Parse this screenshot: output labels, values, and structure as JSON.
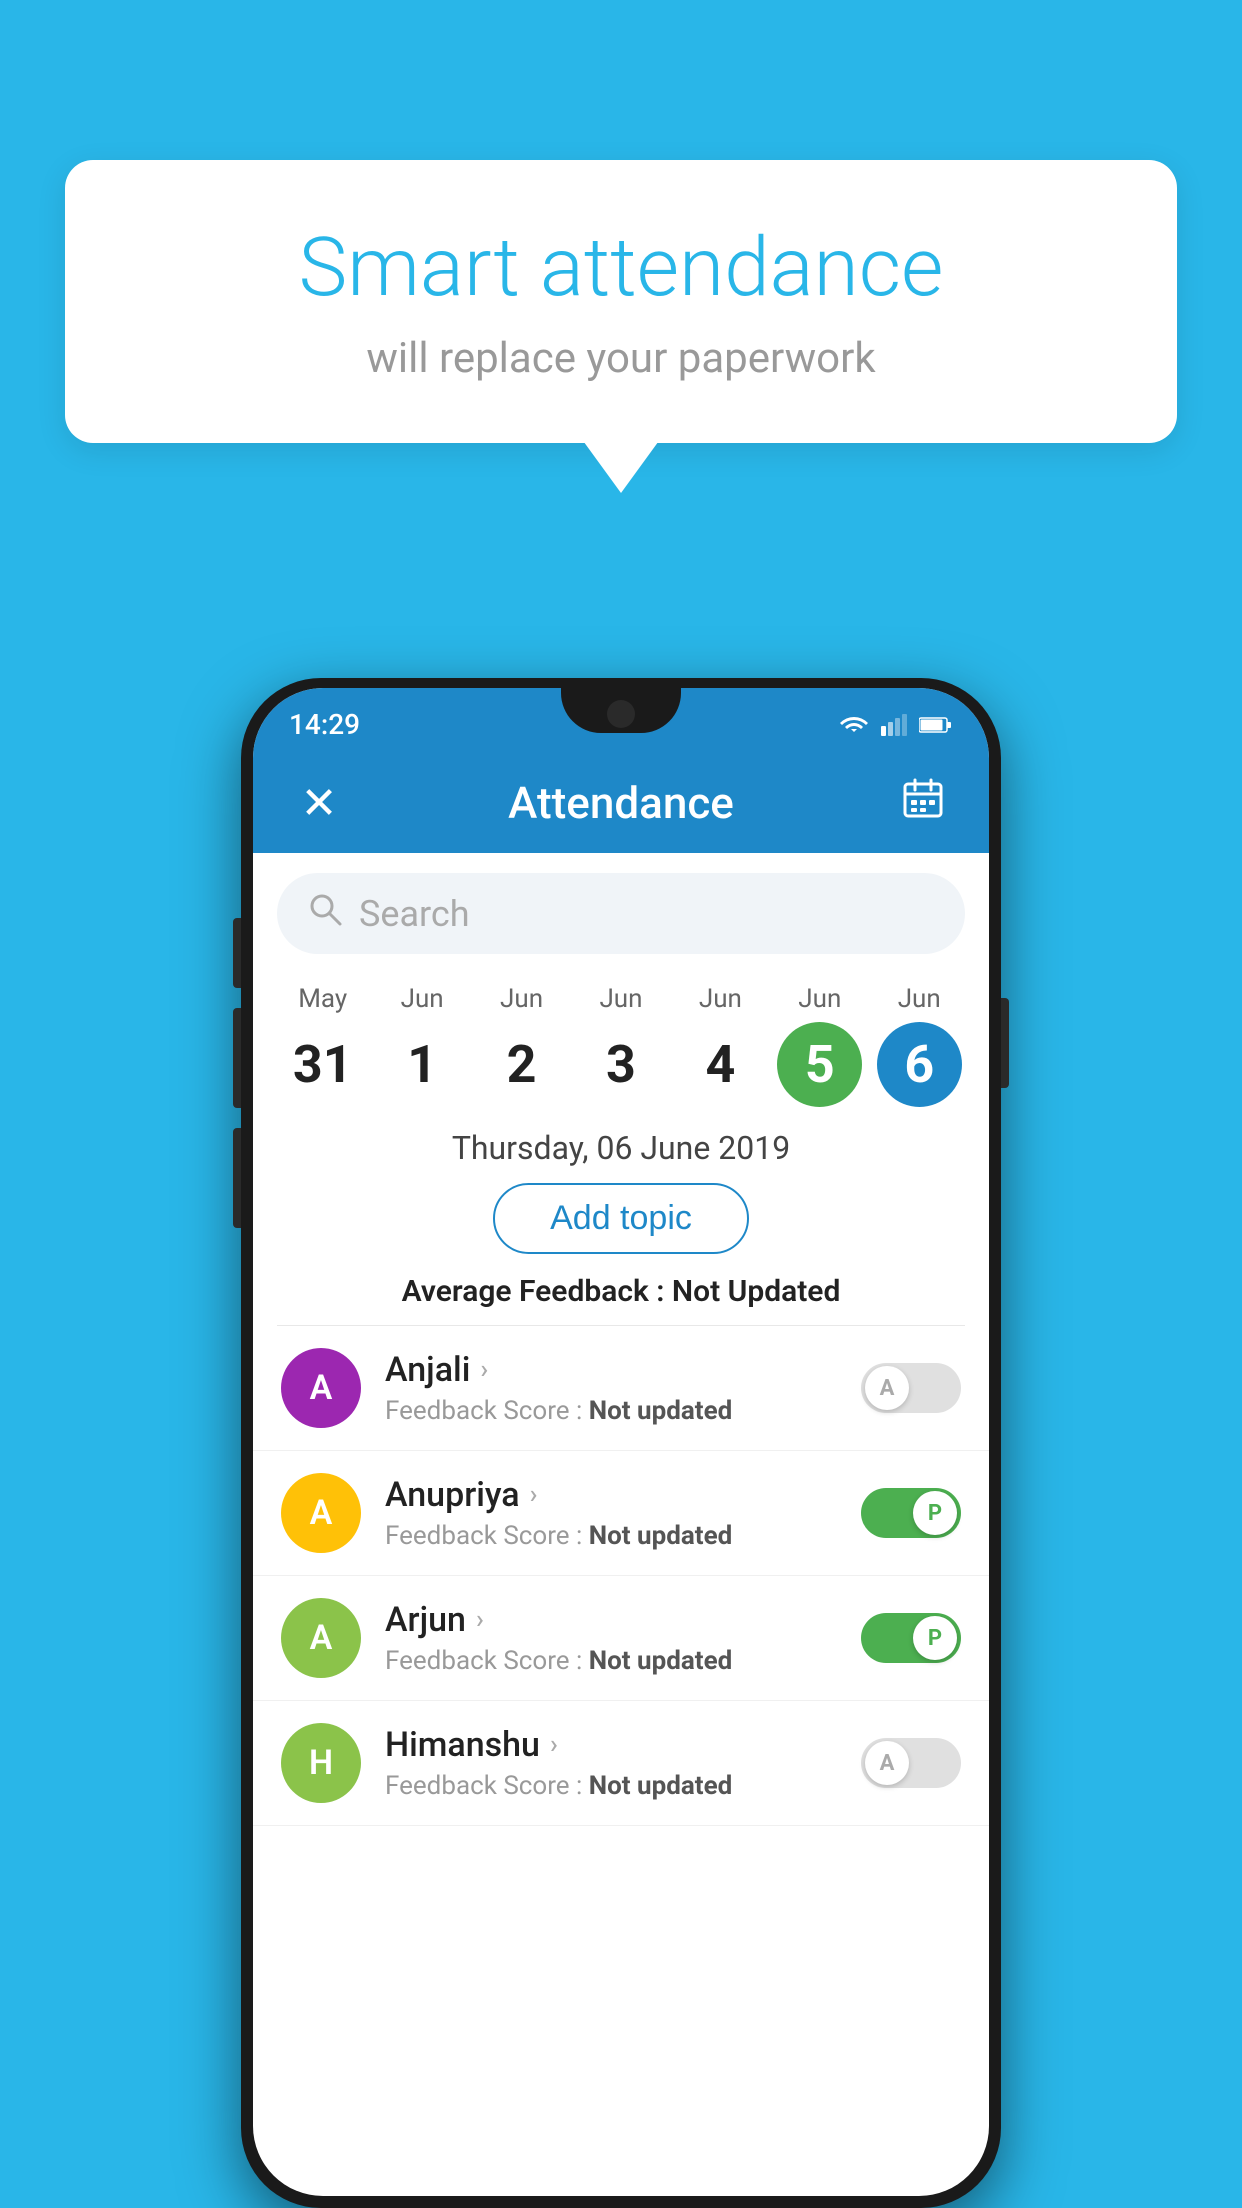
{
  "background_color": "#29b6e8",
  "bubble": {
    "title": "Smart attendance",
    "subtitle": "will replace your paperwork"
  },
  "status_bar": {
    "time": "14:29",
    "icons": [
      "wifi",
      "signal",
      "battery"
    ]
  },
  "app_bar": {
    "title": "Attendance",
    "close_label": "✕",
    "calendar_label": "📅"
  },
  "search": {
    "placeholder": "Search"
  },
  "dates": [
    {
      "month": "May",
      "day": "31",
      "state": "normal"
    },
    {
      "month": "Jun",
      "day": "1",
      "state": "normal"
    },
    {
      "month": "Jun",
      "day": "2",
      "state": "normal"
    },
    {
      "month": "Jun",
      "day": "3",
      "state": "normal"
    },
    {
      "month": "Jun",
      "day": "4",
      "state": "normal"
    },
    {
      "month": "Jun",
      "day": "5",
      "state": "today"
    },
    {
      "month": "Jun",
      "day": "6",
      "state": "selected"
    }
  ],
  "selected_date_label": "Thursday, 06 June 2019",
  "add_topic_label": "Add topic",
  "average_feedback": {
    "label": "Average Feedback : ",
    "value": "Not Updated"
  },
  "students": [
    {
      "name": "Anjali",
      "initial": "A",
      "avatar_color": "#9c27b0",
      "feedback": "Not updated",
      "attendance": "absent"
    },
    {
      "name": "Anupriya",
      "initial": "A",
      "avatar_color": "#ffc107",
      "feedback": "Not updated",
      "attendance": "present"
    },
    {
      "name": "Arjun",
      "initial": "A",
      "avatar_color": "#8bc34a",
      "feedback": "Not updated",
      "attendance": "present"
    },
    {
      "name": "Himanshu",
      "initial": "H",
      "avatar_color": "#8bc34a",
      "feedback": "Not updated",
      "attendance": "absent"
    }
  ]
}
